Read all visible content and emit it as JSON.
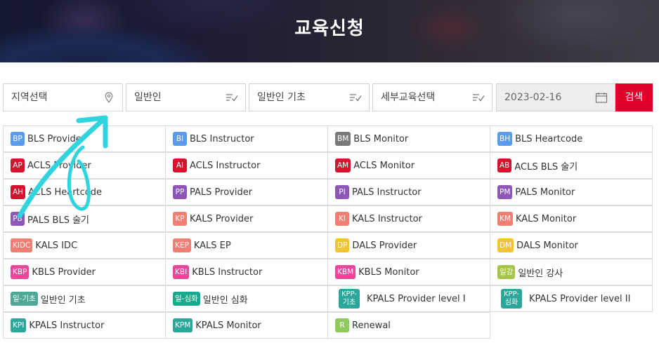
{
  "header": {
    "title": "교육신청"
  },
  "filters": {
    "region": {
      "label": "지역선택",
      "icon": "map-pin-icon"
    },
    "category": {
      "label": "일반인",
      "icon": "list-check-icon"
    },
    "course": {
      "label": "일반인 기초",
      "icon": "list-check-icon"
    },
    "detail": {
      "label": "세부교육선택",
      "icon": "list-check-icon"
    },
    "date": {
      "value": "2023-02-16",
      "icon": "calendar-icon"
    },
    "search_label": "검색"
  },
  "courses": [
    {
      "badge": "BP",
      "label": "BLS Provider",
      "color": "#5b9bef"
    },
    {
      "badge": "BI",
      "label": "BLS Instructor",
      "color": "#5b9bef"
    },
    {
      "badge": "BM",
      "label": "BLS Monitor",
      "color": "#7a7a7a"
    },
    {
      "badge": "BH",
      "label": "BLS Heartcode",
      "color": "#5b9bef"
    },
    {
      "badge": "AP",
      "label": "ACLS Provider",
      "color": "#d2142e"
    },
    {
      "badge": "AI",
      "label": "ACLS Instructor",
      "color": "#d2142e"
    },
    {
      "badge": "AM",
      "label": "ACLS Monitor",
      "color": "#d2142e"
    },
    {
      "badge": "AB",
      "label": "ACLS BLS 술기",
      "color": "#d2142e"
    },
    {
      "badge": "AH",
      "label": "ACLS Heartcode",
      "color": "#d2142e"
    },
    {
      "badge": "PP",
      "label": "PALS Provider",
      "color": "#8e57b7"
    },
    {
      "badge": "PI",
      "label": "PALS Instructor",
      "color": "#8e57b7"
    },
    {
      "badge": "PM",
      "label": "PALS Monitor",
      "color": "#8e57b7"
    },
    {
      "badge": "PB",
      "label": "PALS BLS 술기",
      "color": "#8e57b7"
    },
    {
      "badge": "KP",
      "label": "KALS Provider",
      "color": "#f07f73"
    },
    {
      "badge": "KI",
      "label": "KALS Instructor",
      "color": "#f07f73"
    },
    {
      "badge": "KM",
      "label": "KALS Monitor",
      "color": "#f07f73"
    },
    {
      "badge": "KIDC",
      "label": "KALS IDC",
      "color": "#f07f73"
    },
    {
      "badge": "KEP",
      "label": "KALS EP",
      "color": "#f07f73"
    },
    {
      "badge": "DP",
      "label": "DALS Provider",
      "color": "#f2c433"
    },
    {
      "badge": "DM",
      "label": "DALS Monitor",
      "color": "#f2c433"
    },
    {
      "badge": "KBP",
      "label": "KBLS Provider",
      "color": "#e8489b"
    },
    {
      "badge": "KBI",
      "label": "KBLS Instructor",
      "color": "#e8489b"
    },
    {
      "badge": "KBM",
      "label": "KBLS Monitor",
      "color": "#e8489b"
    },
    {
      "badge": "일강",
      "label": "일반인 강사",
      "color": "#a7c44a"
    },
    {
      "badge": "일-기초",
      "label": "일반인 기초",
      "color": "#4fa893"
    },
    {
      "badge": "일-심화",
      "label": "일반인 심화",
      "color": "#1aa98b"
    },
    {
      "badge": "KPP-기초",
      "badge_lines": [
        "KPP-",
        "기초"
      ],
      "label": "KPALS Provider level I",
      "color": "#2aa69a"
    },
    {
      "badge": "KPP-심화",
      "badge_lines": [
        "KPP-",
        "심화"
      ],
      "label": "KPALS Provider level II",
      "color": "#2aa69a"
    },
    {
      "badge": "KPI",
      "label": "KPALS Instructor",
      "color": "#2aa69a"
    },
    {
      "badge": "KPM",
      "label": "KPALS Monitor",
      "color": "#2aa69a"
    },
    {
      "badge": "R",
      "label": "Renewal",
      "color": "#8ecb5a"
    }
  ]
}
